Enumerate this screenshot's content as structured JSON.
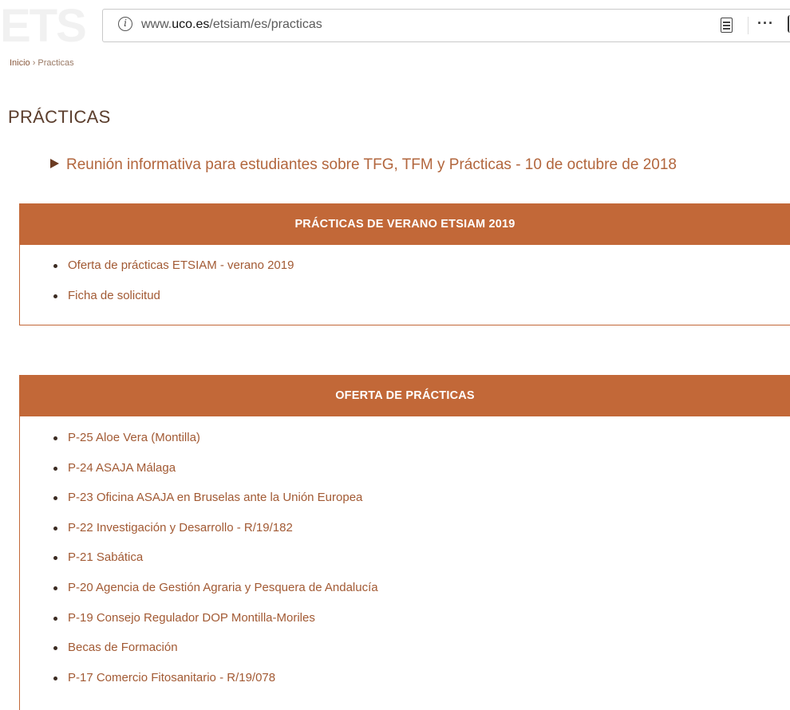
{
  "browser": {
    "url_prefix": "www.",
    "url_domain": "uco.es",
    "url_path": "/etsiam/es/practicas"
  },
  "breadcrumb": {
    "home": "Inicio",
    "separator": "›",
    "current": "Practicas"
  },
  "page": {
    "title": "PRÁCTICAS",
    "featured_link": "Reunión informativa para estudiantes sobre TFG, TFM y Prácticas - 10 de octubre de 2018"
  },
  "panels": {
    "verano": {
      "title": "PRÁCTICAS DE VERANO ETSIAM 2019",
      "items": [
        "Oferta de prácticas ETSIAM - verano 2019",
        "Ficha de solicitud"
      ]
    },
    "oferta": {
      "title": "OFERTA DE PRÁCTICAS",
      "items": [
        "P-25 Aloe Vera (Montilla)",
        "P-24 ASAJA Málaga",
        "P-23 Oficina ASAJA en Bruselas ante la Unión Europea",
        "P-22 Investigación y Desarrollo - R/19/182",
        "P-21 Sabática",
        "P-20 Agencia de Gestión Agraria y Pesquera de Andalucía",
        "P-19 Consejo Regulador DOP Montilla-Moriles",
        "Becas de Formación",
        "P-17 Comercio Fitosanitario - R/19/078"
      ]
    }
  },
  "colors": {
    "panel_header": "#c26838",
    "link": "#a25a34",
    "title": "#5b3e2d"
  },
  "icons": [
    "info-icon",
    "reader-view-icon",
    "more-options-icon",
    "triangle-arrow-icon",
    "bullet-icon"
  ]
}
